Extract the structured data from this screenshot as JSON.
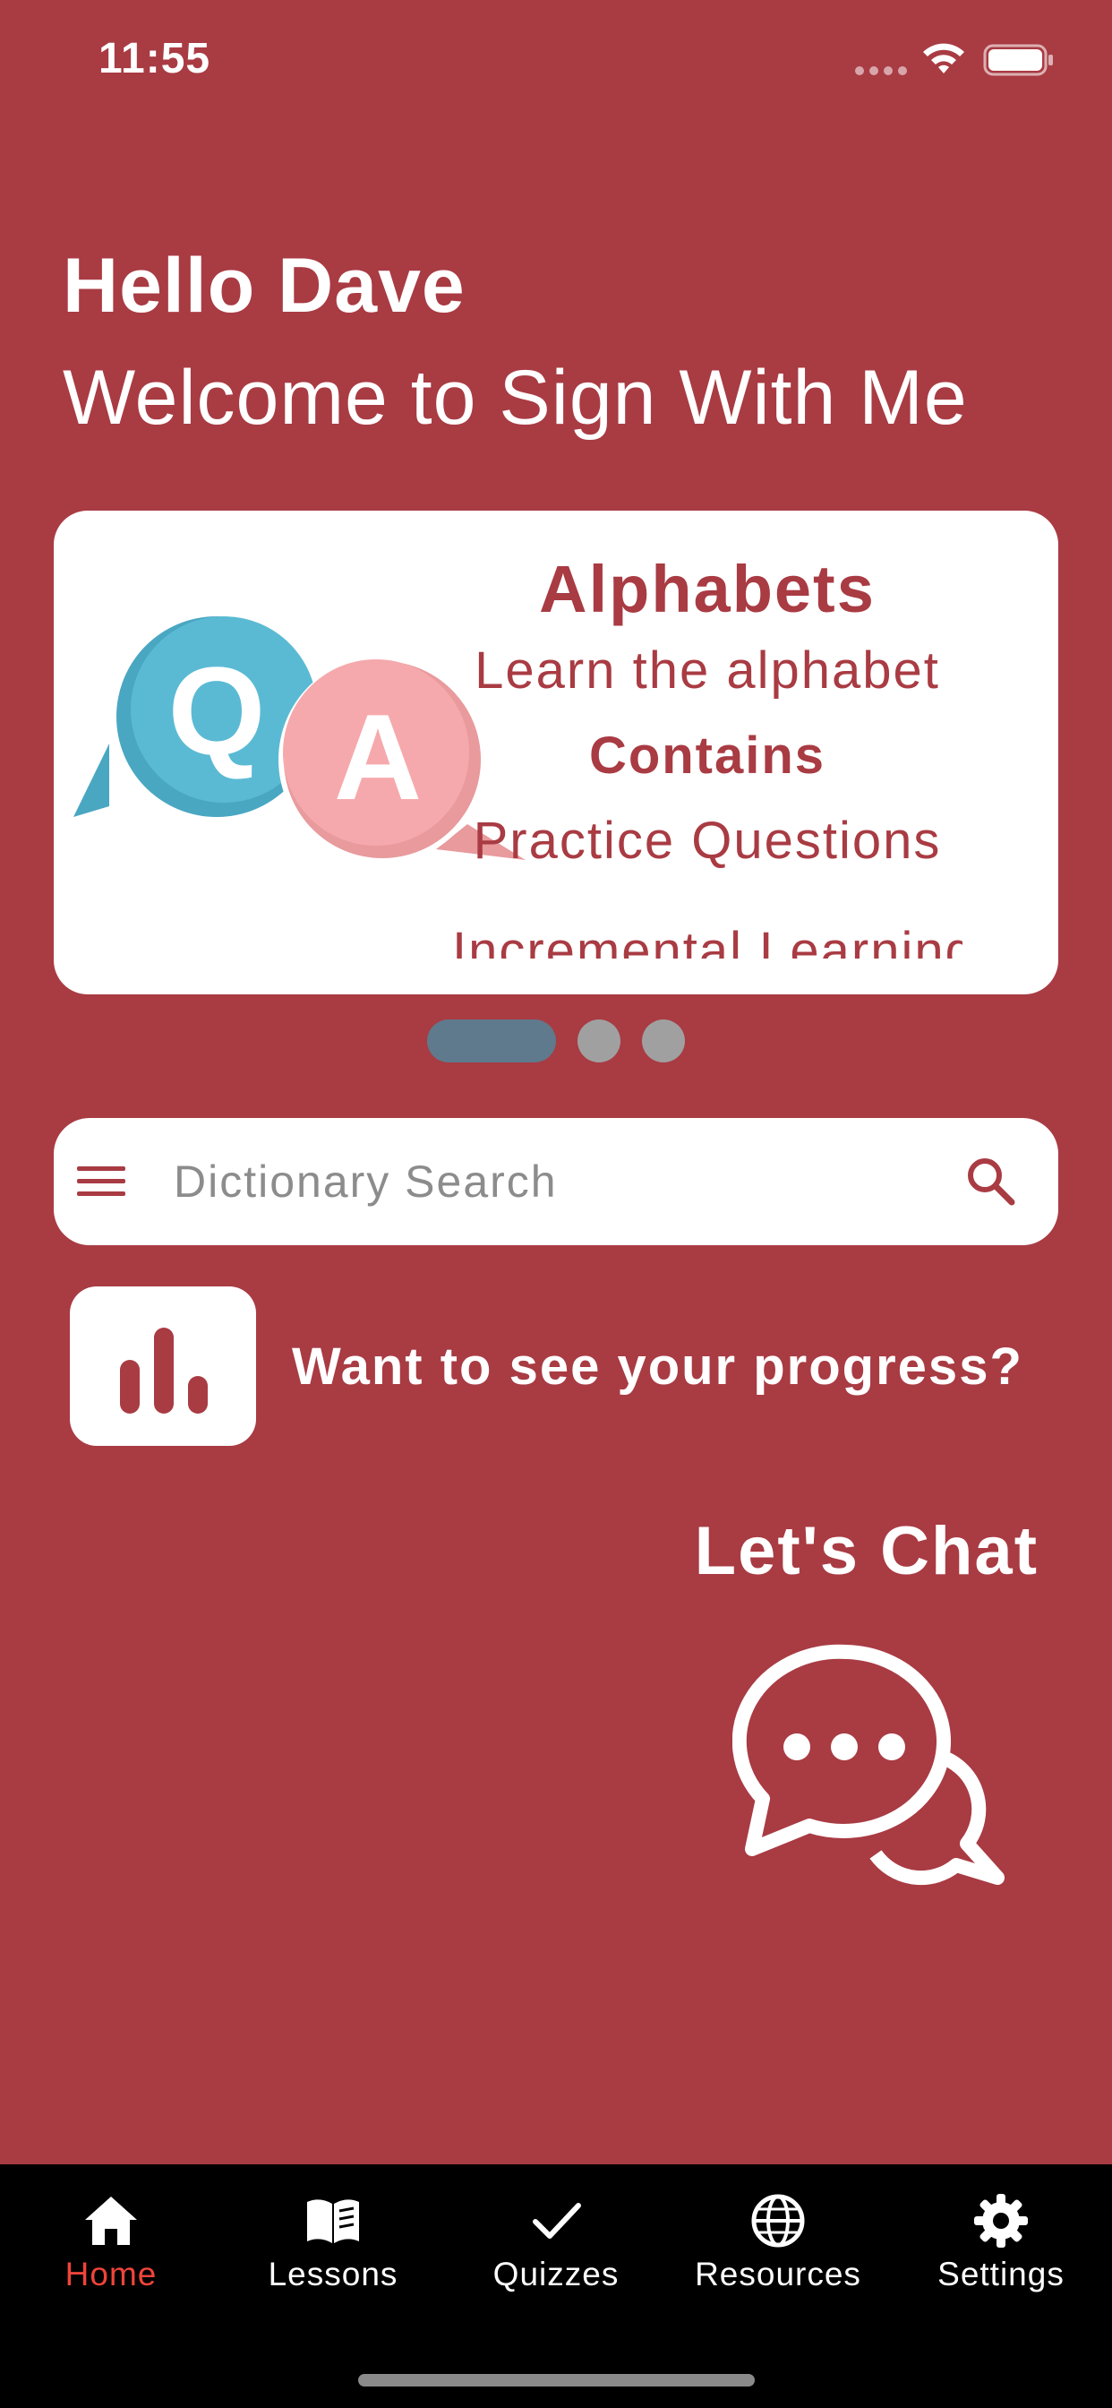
{
  "status_bar": {
    "time": "11:55"
  },
  "header": {
    "greeting": "Hello Dave",
    "welcome": "Welcome to Sign With Me"
  },
  "carousel": {
    "card": {
      "illustration_letters": [
        "Q",
        "A"
      ],
      "title": "Alphabets",
      "line1": "Learn the alphabet",
      "contains_label": "Contains",
      "line3": "Practice Questions",
      "line4": "Incremental Learning"
    },
    "page_count": 3,
    "active_page": 1
  },
  "search": {
    "placeholder": "Dictionary Search",
    "value": ""
  },
  "progress": {
    "label": "Want to see your progress?"
  },
  "chat": {
    "title": "Let's Chat"
  },
  "tab_bar": {
    "active_color": "#F0443A",
    "items": [
      {
        "label": "Home",
        "icon": "home-icon",
        "active": true
      },
      {
        "label": "Lessons",
        "icon": "book-icon",
        "active": false
      },
      {
        "label": "Quizzes",
        "icon": "check-icon",
        "active": false
      },
      {
        "label": "Resources",
        "icon": "globe-icon",
        "active": false
      },
      {
        "label": "Settings",
        "icon": "gear-icon",
        "active": false
      }
    ]
  },
  "colors": {
    "background": "#A93B43",
    "card": "#FFFFFF",
    "pager_active": "#5E7A8C",
    "pager_inactive": "#A0A0A0",
    "q_bubble": "#5BBAD3",
    "a_bubble": "#F6A9AC"
  }
}
